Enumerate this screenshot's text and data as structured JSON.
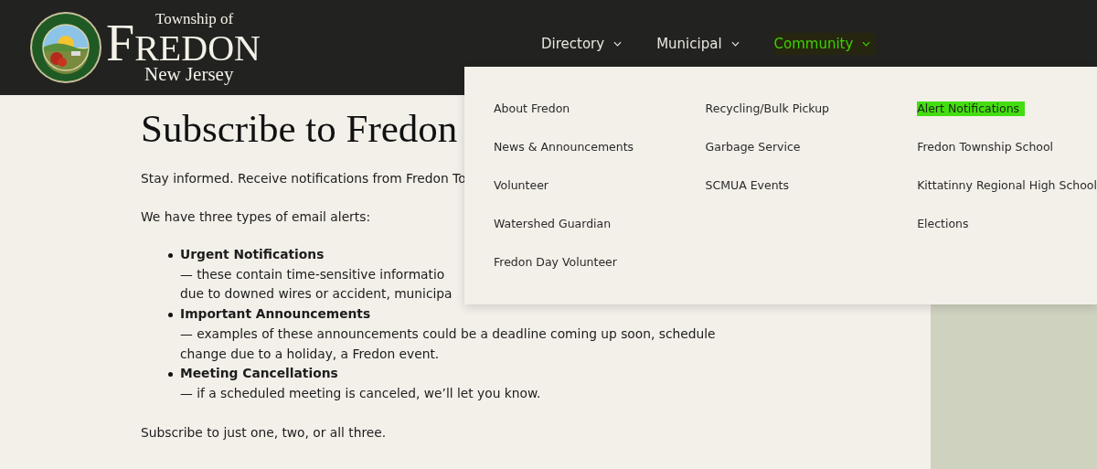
{
  "header": {
    "logo": {
      "line_1": "Township of",
      "line_2": "FREDON",
      "line_3": "New Jersey"
    },
    "nav": [
      {
        "label": "Directory",
        "expanded": false
      },
      {
        "label": "Municipal",
        "expanded": false
      },
      {
        "label": "Community",
        "expanded": true
      }
    ]
  },
  "dropdown": {
    "columns": [
      [
        {
          "label": "About Fredon",
          "selected": false
        },
        {
          "label": "News & Announcements",
          "selected": false
        },
        {
          "label": "Volunteer",
          "selected": false
        },
        {
          "label": "Watershed Guardian",
          "selected": false
        },
        {
          "label": "Fredon Day Volunteer",
          "selected": false
        }
      ],
      [
        {
          "label": "Recycling/Bulk Pickup",
          "selected": false
        },
        {
          "label": "Garbage Service",
          "selected": false
        },
        {
          "label": "SCMUA Events",
          "selected": false
        }
      ],
      [
        {
          "label": "Alert Notifications",
          "selected": true
        },
        {
          "label": "Fredon Township School",
          "selected": false
        },
        {
          "label": "Kittatinny Regional High School",
          "selected": false
        },
        {
          "label": "Elections",
          "selected": false
        }
      ]
    ]
  },
  "content": {
    "title": "Subscribe to Fredon",
    "intro": "Stay informed. Receive notifications from Fredon To",
    "lead": "We have three types of email alerts:",
    "alerts": [
      {
        "name": "Urgent Notifications",
        "lines": [
          "— these contain time-sensitive informatio",
          "due to downed wires or accident, municipa"
        ]
      },
      {
        "name": "Important Announcements",
        "lines": [
          "— examples of these announcements could be a deadline coming up soon, schedule",
          "change due to a holiday, a Fredon event."
        ]
      },
      {
        "name": "Meeting Cancellations",
        "lines": [
          "— if a scheduled meeting is canceled, we’ll let you know."
        ]
      }
    ],
    "closing": "Subscribe to just one, two, or all three."
  }
}
